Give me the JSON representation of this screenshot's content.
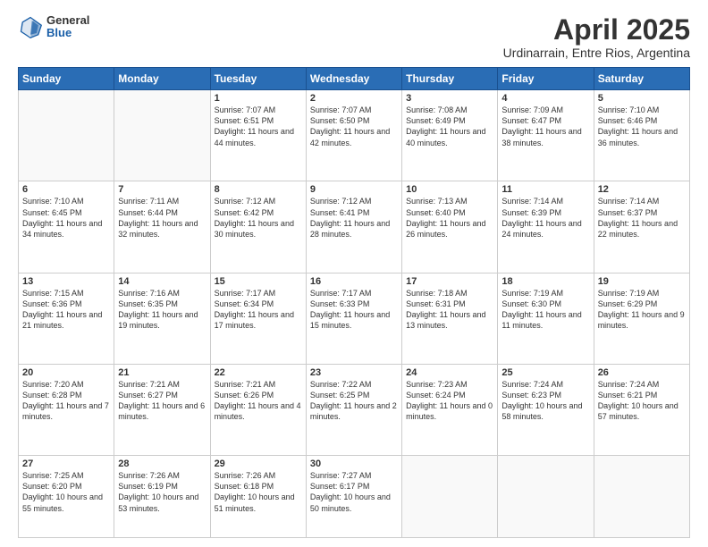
{
  "header": {
    "logo": {
      "general": "General",
      "blue": "Blue"
    },
    "month_title": "April 2025",
    "subtitle": "Urdinarrain, Entre Rios, Argentina"
  },
  "weekdays": [
    "Sunday",
    "Monday",
    "Tuesday",
    "Wednesday",
    "Thursday",
    "Friday",
    "Saturday"
  ],
  "weeks": [
    [
      {
        "day": "",
        "empty": true
      },
      {
        "day": "",
        "empty": true
      },
      {
        "day": "1",
        "sunrise": "Sunrise: 7:07 AM",
        "sunset": "Sunset: 6:51 PM",
        "daylight": "Daylight: 11 hours and 44 minutes."
      },
      {
        "day": "2",
        "sunrise": "Sunrise: 7:07 AM",
        "sunset": "Sunset: 6:50 PM",
        "daylight": "Daylight: 11 hours and 42 minutes."
      },
      {
        "day": "3",
        "sunrise": "Sunrise: 7:08 AM",
        "sunset": "Sunset: 6:49 PM",
        "daylight": "Daylight: 11 hours and 40 minutes."
      },
      {
        "day": "4",
        "sunrise": "Sunrise: 7:09 AM",
        "sunset": "Sunset: 6:47 PM",
        "daylight": "Daylight: 11 hours and 38 minutes."
      },
      {
        "day": "5",
        "sunrise": "Sunrise: 7:10 AM",
        "sunset": "Sunset: 6:46 PM",
        "daylight": "Daylight: 11 hours and 36 minutes."
      }
    ],
    [
      {
        "day": "6",
        "sunrise": "Sunrise: 7:10 AM",
        "sunset": "Sunset: 6:45 PM",
        "daylight": "Daylight: 11 hours and 34 minutes."
      },
      {
        "day": "7",
        "sunrise": "Sunrise: 7:11 AM",
        "sunset": "Sunset: 6:44 PM",
        "daylight": "Daylight: 11 hours and 32 minutes."
      },
      {
        "day": "8",
        "sunrise": "Sunrise: 7:12 AM",
        "sunset": "Sunset: 6:42 PM",
        "daylight": "Daylight: 11 hours and 30 minutes."
      },
      {
        "day": "9",
        "sunrise": "Sunrise: 7:12 AM",
        "sunset": "Sunset: 6:41 PM",
        "daylight": "Daylight: 11 hours and 28 minutes."
      },
      {
        "day": "10",
        "sunrise": "Sunrise: 7:13 AM",
        "sunset": "Sunset: 6:40 PM",
        "daylight": "Daylight: 11 hours and 26 minutes."
      },
      {
        "day": "11",
        "sunrise": "Sunrise: 7:14 AM",
        "sunset": "Sunset: 6:39 PM",
        "daylight": "Daylight: 11 hours and 24 minutes."
      },
      {
        "day": "12",
        "sunrise": "Sunrise: 7:14 AM",
        "sunset": "Sunset: 6:37 PM",
        "daylight": "Daylight: 11 hours and 22 minutes."
      }
    ],
    [
      {
        "day": "13",
        "sunrise": "Sunrise: 7:15 AM",
        "sunset": "Sunset: 6:36 PM",
        "daylight": "Daylight: 11 hours and 21 minutes."
      },
      {
        "day": "14",
        "sunrise": "Sunrise: 7:16 AM",
        "sunset": "Sunset: 6:35 PM",
        "daylight": "Daylight: 11 hours and 19 minutes."
      },
      {
        "day": "15",
        "sunrise": "Sunrise: 7:17 AM",
        "sunset": "Sunset: 6:34 PM",
        "daylight": "Daylight: 11 hours and 17 minutes."
      },
      {
        "day": "16",
        "sunrise": "Sunrise: 7:17 AM",
        "sunset": "Sunset: 6:33 PM",
        "daylight": "Daylight: 11 hours and 15 minutes."
      },
      {
        "day": "17",
        "sunrise": "Sunrise: 7:18 AM",
        "sunset": "Sunset: 6:31 PM",
        "daylight": "Daylight: 11 hours and 13 minutes."
      },
      {
        "day": "18",
        "sunrise": "Sunrise: 7:19 AM",
        "sunset": "Sunset: 6:30 PM",
        "daylight": "Daylight: 11 hours and 11 minutes."
      },
      {
        "day": "19",
        "sunrise": "Sunrise: 7:19 AM",
        "sunset": "Sunset: 6:29 PM",
        "daylight": "Daylight: 11 hours and 9 minutes."
      }
    ],
    [
      {
        "day": "20",
        "sunrise": "Sunrise: 7:20 AM",
        "sunset": "Sunset: 6:28 PM",
        "daylight": "Daylight: 11 hours and 7 minutes."
      },
      {
        "day": "21",
        "sunrise": "Sunrise: 7:21 AM",
        "sunset": "Sunset: 6:27 PM",
        "daylight": "Daylight: 11 hours and 6 minutes."
      },
      {
        "day": "22",
        "sunrise": "Sunrise: 7:21 AM",
        "sunset": "Sunset: 6:26 PM",
        "daylight": "Daylight: 11 hours and 4 minutes."
      },
      {
        "day": "23",
        "sunrise": "Sunrise: 7:22 AM",
        "sunset": "Sunset: 6:25 PM",
        "daylight": "Daylight: 11 hours and 2 minutes."
      },
      {
        "day": "24",
        "sunrise": "Sunrise: 7:23 AM",
        "sunset": "Sunset: 6:24 PM",
        "daylight": "Daylight: 11 hours and 0 minutes."
      },
      {
        "day": "25",
        "sunrise": "Sunrise: 7:24 AM",
        "sunset": "Sunset: 6:23 PM",
        "daylight": "Daylight: 10 hours and 58 minutes."
      },
      {
        "day": "26",
        "sunrise": "Sunrise: 7:24 AM",
        "sunset": "Sunset: 6:21 PM",
        "daylight": "Daylight: 10 hours and 57 minutes."
      }
    ],
    [
      {
        "day": "27",
        "sunrise": "Sunrise: 7:25 AM",
        "sunset": "Sunset: 6:20 PM",
        "daylight": "Daylight: 10 hours and 55 minutes."
      },
      {
        "day": "28",
        "sunrise": "Sunrise: 7:26 AM",
        "sunset": "Sunset: 6:19 PM",
        "daylight": "Daylight: 10 hours and 53 minutes."
      },
      {
        "day": "29",
        "sunrise": "Sunrise: 7:26 AM",
        "sunset": "Sunset: 6:18 PM",
        "daylight": "Daylight: 10 hours and 51 minutes."
      },
      {
        "day": "30",
        "sunrise": "Sunrise: 7:27 AM",
        "sunset": "Sunset: 6:17 PM",
        "daylight": "Daylight: 10 hours and 50 minutes."
      },
      {
        "day": "",
        "empty": true
      },
      {
        "day": "",
        "empty": true
      },
      {
        "day": "",
        "empty": true
      }
    ]
  ]
}
